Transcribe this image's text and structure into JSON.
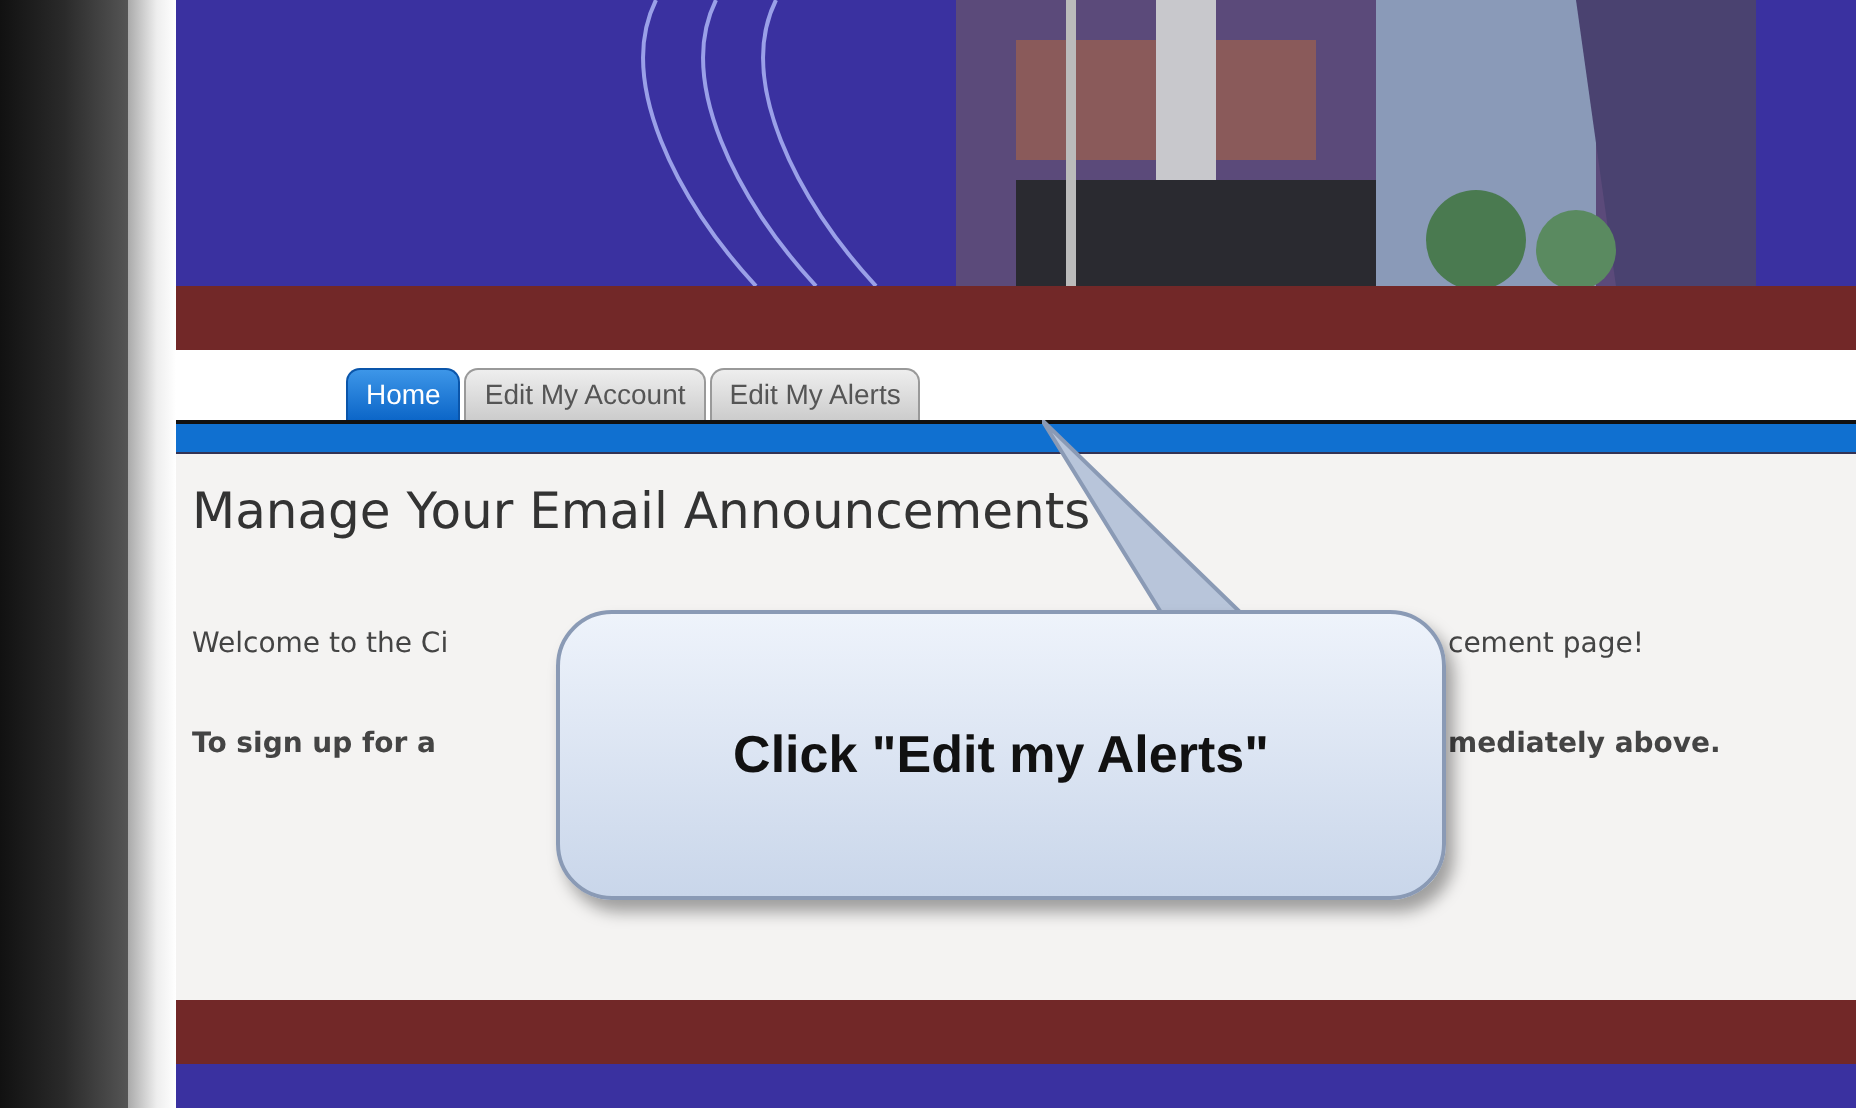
{
  "tabs": [
    {
      "label": "Home",
      "selected": true
    },
    {
      "label": "Edit My Account",
      "selected": false
    },
    {
      "label": "Edit My Alerts",
      "selected": false
    }
  ],
  "heading": "Manage Your Email Announcements",
  "lines": [
    {
      "start": "Welcome to the Ci",
      "end": "cement page!",
      "bold": false
    },
    {
      "start": "To sign up for a",
      "end": "mediately above.",
      "bold": true
    }
  ],
  "callout": {
    "text": "Click \"Edit my Alerts\""
  }
}
